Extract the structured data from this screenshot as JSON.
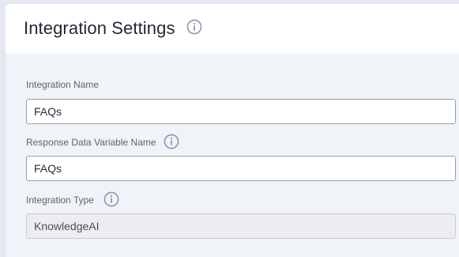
{
  "header": {
    "title": "Integration Settings",
    "info_icon": "info-icon"
  },
  "form": {
    "integration_name": {
      "label": "Integration Name",
      "value": "FAQs"
    },
    "response_variable": {
      "label": "Response Data Variable Name",
      "value": "FAQs",
      "info_icon": "info-icon"
    },
    "integration_type": {
      "label": "Integration Type",
      "value": "KnowledgeAI",
      "disabled": true,
      "info_icon": "info-icon"
    }
  },
  "colors": {
    "page_background": "#e3e8f1",
    "panel_background": "#f0f3f7",
    "header_background": "#ffffff",
    "info_icon": "#8b97ad"
  }
}
